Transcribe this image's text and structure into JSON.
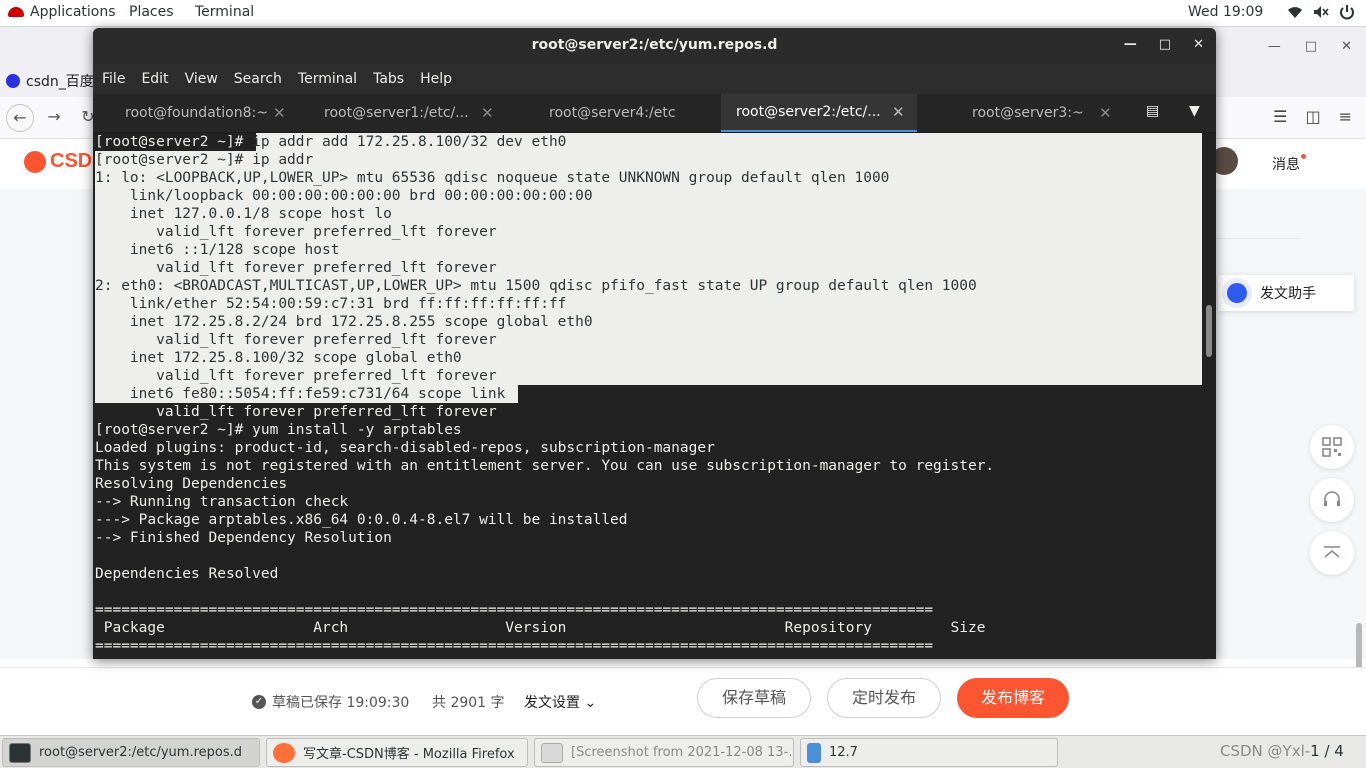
{
  "topbar": {
    "applications": "Applications",
    "places": "Places",
    "terminal": "Terminal",
    "clock": "Wed 19:09"
  },
  "firefox": {
    "tab_label": "csdn_百度",
    "logo_text": "CSDN",
    "messages": "消息",
    "assistant": "发文助手",
    "saved_status": "草稿已保存 19:09:30",
    "word_count": "共 2901 字",
    "publish_settings": "发文设置",
    "save_draft": "保存草稿",
    "schedule": "定时发布",
    "publish": "发布博客",
    "colors": {
      "accent": "#fc5531"
    }
  },
  "taskbar": {
    "items": [
      {
        "label": "root@server2:/etc/yum.repos.d"
      },
      {
        "label": "写文章-CSDN博客 - Mozilla Firefox"
      },
      {
        "label": "[Screenshot from 2021-12-08 13-..."
      },
      {
        "label": "12.7"
      }
    ],
    "page_indicator": "1 / 4",
    "watermark": "CSDN @Yxl-"
  },
  "terminal": {
    "title": "root@server2:/etc/yum.repos.d",
    "menu": [
      "File",
      "Edit",
      "View",
      "Search",
      "Terminal",
      "Tabs",
      "Help"
    ],
    "tabs": [
      {
        "label": "root@foundation8:~"
      },
      {
        "label": "root@server1:/etc/..."
      },
      {
        "label": "root@server4:/etc"
      },
      {
        "label": "root@server2:/etc/..."
      },
      {
        "label": "root@server3:~"
      }
    ],
    "first_prompt": "[root@server2 ~]# ",
    "first_cmd": "ip addr add 172.25.8.100/32 dev eth0",
    "sel_lines": [
      "[root@server2 ~]# ip addr",
      "1: lo: <LOOPBACK,UP,LOWER_UP> mtu 65536 qdisc noqueue state UNKNOWN group default qlen 1000",
      "    link/loopback 00:00:00:00:00:00 brd 00:00:00:00:00:00",
      "    inet 127.0.0.1/8 scope host lo",
      "       valid_lft forever preferred_lft forever",
      "    inet6 ::1/128 scope host",
      "       valid_lft forever preferred_lft forever",
      "2: eth0: <BROADCAST,MULTICAST,UP,LOWER_UP> mtu 1500 qdisc pfifo_fast state UP group default qlen 1000",
      "    link/ether 52:54:00:59:c7:31 brd ff:ff:ff:ff:ff:ff",
      "    inet 172.25.8.2/24 brd 172.25.8.255 scope global eth0",
      "       valid_lft forever preferred_lft forever",
      "    inet 172.25.8.100/32 scope global eth0",
      "       valid_lft forever preferred_lft forever"
    ],
    "sel_last_line": "    inet6 fe80::5054:ff:fe59:c731/64 scope link",
    "plain_lines": [
      "       valid_lft forever preferred_lft forever",
      "[root@server2 ~]# yum install -y arptables",
      "Loaded plugins: product-id, search-disabled-repos, subscription-manager",
      "This system is not registered with an entitlement server. You can use subscription-manager to register.",
      "Resolving Dependencies",
      "--> Running transaction check",
      "---> Package arptables.x86_64 0:0.0.4-8.el7 will be installed",
      "--> Finished Dependency Resolution",
      "",
      "Dependencies Resolved",
      "",
      "================================================================================================",
      " Package                 Arch                  Version                         Repository         Size",
      "================================================================================================"
    ]
  }
}
